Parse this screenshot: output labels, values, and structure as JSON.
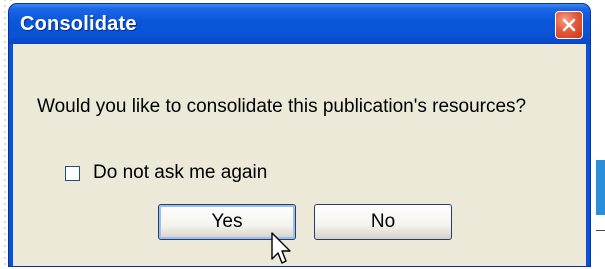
{
  "dialog": {
    "title": "Consolidate",
    "message": "Would you like to consolidate this publication's resources?",
    "checkbox_label": "Do not ask me again",
    "checkbox_checked": false,
    "yes_label": "Yes",
    "no_label": "No"
  },
  "colors": {
    "titlebar": "#0a52d4",
    "client": "#ece9d8",
    "close_button": "#e45a3a"
  },
  "icons": {
    "close": "close-x-icon",
    "cursor": "mouse-pointer-icon"
  }
}
